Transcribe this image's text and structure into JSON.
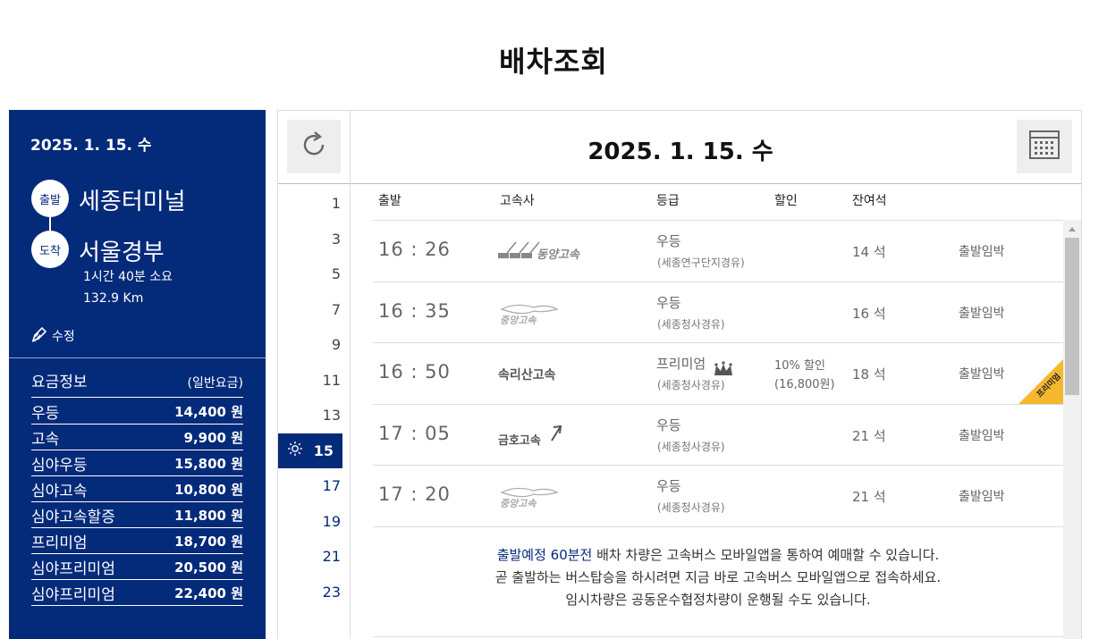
{
  "page_title": "배차조회",
  "summary": {
    "date": "2025. 1. 15. 수",
    "departure_badge": "출발",
    "departure": "세종터미널",
    "arrival_badge": "도착",
    "arrival": "서울경부",
    "duration": "1시간 40분 소요",
    "distance": "132.9 Km",
    "edit_label": "수정"
  },
  "fare_info": {
    "title": "요금정보",
    "subtitle": "(일반요금)",
    "rows": [
      {
        "name": "우등",
        "price": "14,400 원"
      },
      {
        "name": "고속",
        "price": "9,900 원"
      },
      {
        "name": "심야우등",
        "price": "15,800 원"
      },
      {
        "name": "심야고속",
        "price": "10,800 원"
      },
      {
        "name": "심야고속할증",
        "price": "11,800 원"
      },
      {
        "name": "프리미엄",
        "price": "18,700 원"
      },
      {
        "name": "심야프리미엄",
        "price": "20,500 원"
      },
      {
        "name": "심야프리미엄",
        "price": "22,400 원"
      }
    ]
  },
  "selected_date": "2025. 1. 15. 수",
  "icons": {
    "refresh": "refresh-icon",
    "calendar": "calendar-icon",
    "sun": "sun-icon",
    "edit": "pen-icon",
    "crown": "crown-icon"
  },
  "hours": [
    "1",
    "3",
    "5",
    "7",
    "9",
    "11",
    "13",
    "15",
    "17",
    "19",
    "21",
    "23"
  ],
  "selected_hour": "15",
  "table_headers": {
    "depart": "출발",
    "company": "고속사",
    "grade": "등급",
    "discount": "할인",
    "seats": "잔여석"
  },
  "schedules": [
    {
      "time": "16 : 26",
      "company": "동양고속",
      "grade": "우등",
      "via": "(세종연구단지경유)",
      "discount": "",
      "discount_price": "",
      "seats": "14 석",
      "status": "출발임박"
    },
    {
      "time": "16 : 35",
      "company": "중앙고속",
      "grade": "우등",
      "via": "(세종청사경유)",
      "discount": "",
      "discount_price": "",
      "seats": "16 석",
      "status": "출발임박"
    },
    {
      "time": "16 : 50",
      "company": "속리산고속",
      "grade": "프리미엄",
      "via": "(세종청사경유)",
      "discount": "10% 할인",
      "discount_price": "(16,800원)",
      "seats": "18 석",
      "status": "출발임박",
      "tag": "프리미엄"
    },
    {
      "time": "17 : 05",
      "company": "금호고속",
      "grade": "우등",
      "via": "(세종청사경유)",
      "discount": "",
      "discount_price": "",
      "seats": "21 석",
      "status": "출발임박"
    },
    {
      "time": "17 : 20",
      "company": "중앙고속",
      "grade": "우등",
      "via": "(세종청사경유)",
      "discount": "",
      "discount_price": "",
      "seats": "21 석",
      "status": "출발임박"
    }
  ],
  "notice": {
    "highlight": "출발예정 60분전",
    "line1_rest": " 배차 차량은 고속버스 모바일앱을 통하여 예매할 수 있습니다.",
    "line2": "곧 출발하는 버스탑승을 하시려면 지금 바로 고속버스 모바일앱으로 접속하세요.",
    "line3": "임시차량은 공동운수협정차량이 운행될 수도 있습니다."
  },
  "colors": {
    "navy": "#042a7a",
    "premium_tag": "#f5b82e"
  }
}
